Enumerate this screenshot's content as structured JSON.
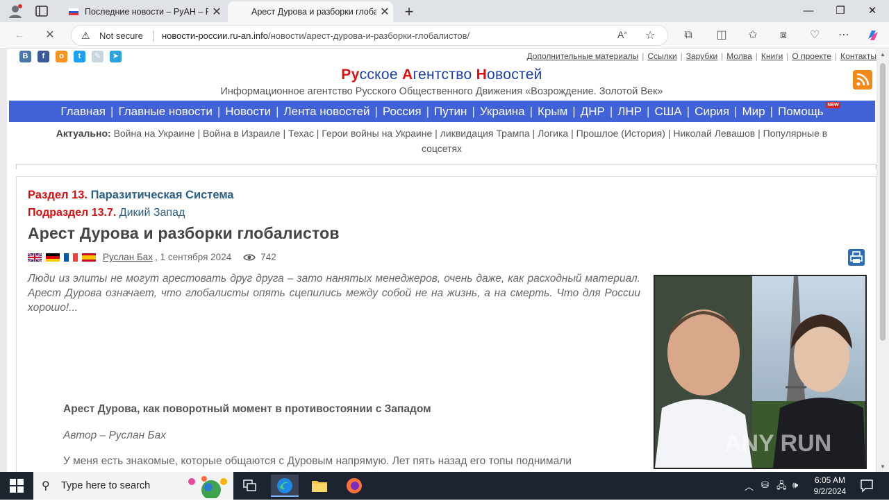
{
  "browser": {
    "tabs": [
      {
        "title": "Последние новости – РуАН – Ру",
        "active": false
      },
      {
        "title": "Арест Дурова и разборки глоба",
        "active": true
      }
    ],
    "security_label": "Not secure",
    "url_host": "новости-россии.ru-an.info",
    "url_path": "/новости/арест-дурова-и-разборки-глобалистов/"
  },
  "site": {
    "top_links": [
      "Дополнительные материалы",
      "Ссылки",
      "Зарубки",
      "Молва",
      "Книги",
      "О проекте",
      "Контакты"
    ],
    "brand": {
      "p1a": "Ру",
      "p1b": "сское ",
      "p2a": "А",
      "p2b": "гентство ",
      "p3a": "Н",
      "p3b": "овостей"
    },
    "tagline": "Информационное агентство Русского Общественного Движения «Возрождение. Золотой Век»",
    "nav": [
      "Главная",
      "Главные новости",
      "Новости",
      "Лента новостей",
      "Россия",
      "Путин",
      "Украина",
      "Крым",
      "ДНР",
      "ЛНР",
      "США",
      "Сирия",
      "Мир",
      "Помощь"
    ],
    "nav_badge": "NEW",
    "actual_label": "Актуально:",
    "actual_items": [
      "Война на Украине",
      "Война в Израиле",
      "Техас",
      "Герои войны на Украине",
      "ликвидация Трампа",
      "Логика",
      "Прошлое (История)",
      "Николай Левашов",
      "Популярные в соцсетях"
    ]
  },
  "article": {
    "section_label": "Раздел 13.",
    "section_value": "Паразитическая Система",
    "subsection_label": "Подраздел 13.7.",
    "subsection_value": "Дикий Запад",
    "title": "Арест Дурова и разборки глобалистов",
    "author": "Руслан Бах",
    "date": ", 1 сентября 2024",
    "views": "742",
    "lead": "Люди из элиты не могут арестовать друг друга – зато нанятых менеджеров, очень даже, как расходный материал. Арест Дурова означает, что глобалисты опять сцепились между собой не на жизнь, а на смерть. Что для России хорошо!...",
    "subheading": "Арест Дурова, как поворотный момент в противостоянии с Западом",
    "byline": "Автор – Руслан Бах",
    "paragraph": "У меня есть знакомые, которые общаются с Дуровым напрямую. Лет пять назад его топы поднимали",
    "watermark": "ANY RUN"
  },
  "taskbar": {
    "search_placeholder": "Type here to search",
    "time": "6:05 AM",
    "date": "9/2/2024"
  }
}
